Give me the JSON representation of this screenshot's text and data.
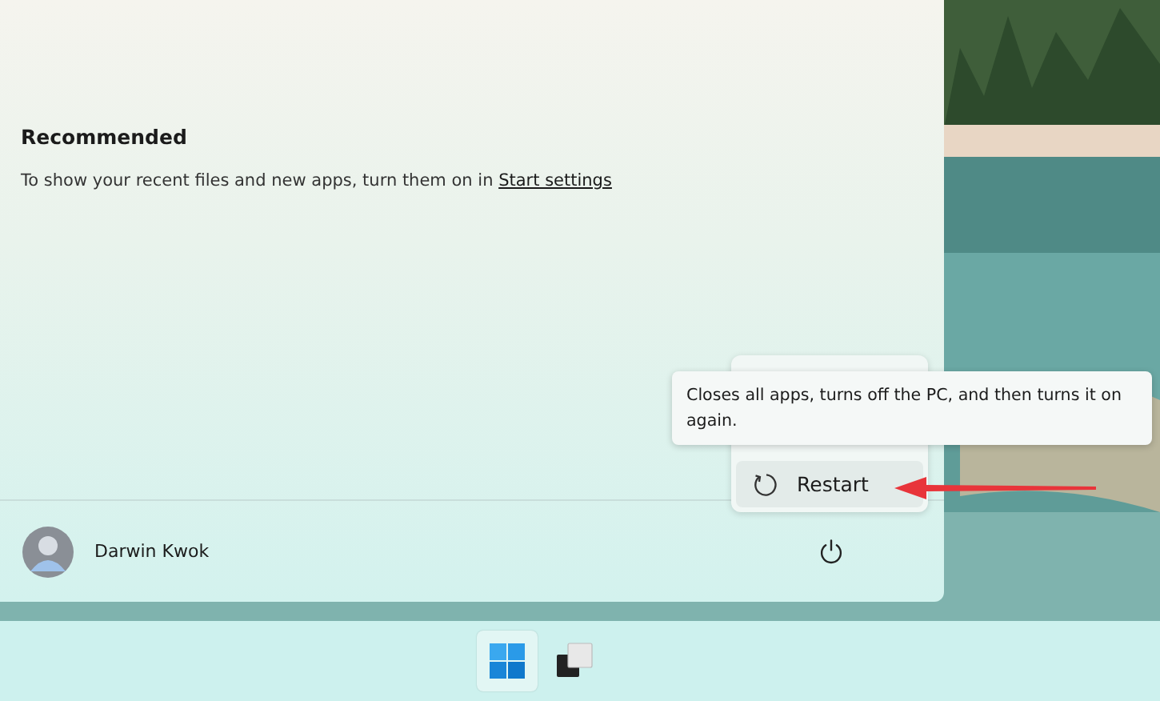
{
  "start_menu": {
    "recommended": {
      "heading": "Recommended",
      "message": "To show your recent files and new apps, turn them on in",
      "link": "Start settings"
    },
    "user": {
      "name": "Darwin Kwok"
    }
  },
  "power_menu": {
    "items": [
      {
        "label": "Restart",
        "selected": true
      }
    ]
  },
  "tooltip": "Closes all apps, turns off the PC, and then turns it on again.",
  "taskbar": {
    "items": [
      {
        "kind": "start",
        "selected": true
      },
      {
        "kind": "task-view",
        "selected": false
      }
    ]
  }
}
